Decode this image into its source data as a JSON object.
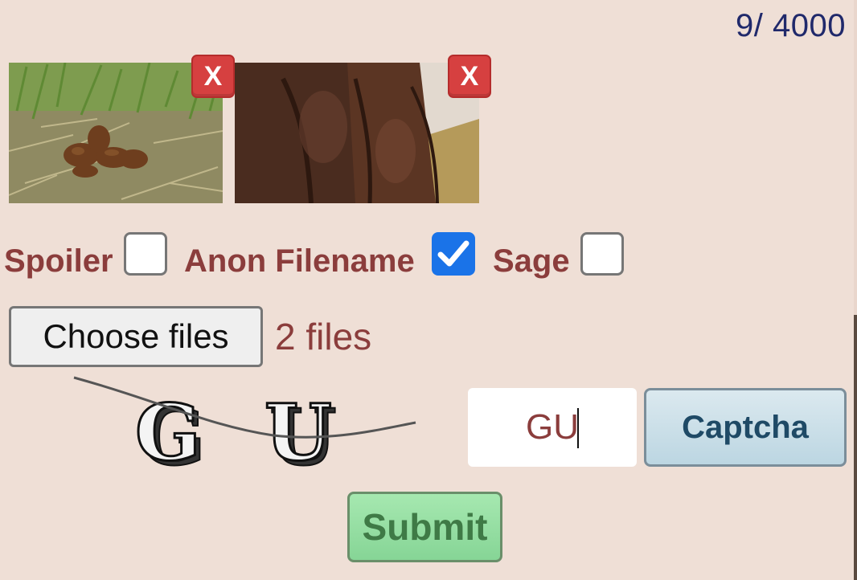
{
  "counter": {
    "text": "9/ 4000"
  },
  "attachments": [
    {
      "remove_label": "X",
      "icon": "photo-thumbnail"
    },
    {
      "remove_label": "X",
      "icon": "photo-thumbnail"
    }
  ],
  "options": {
    "spoiler": {
      "label": "Spoiler",
      "checked": false
    },
    "anon_filename": {
      "label": "Anon Filename",
      "checked": true
    },
    "sage": {
      "label": "Sage",
      "checked": false
    }
  },
  "files": {
    "button_label": "Choose files",
    "status": "2 files"
  },
  "captcha": {
    "image_text": "G U",
    "input_value": "GU",
    "button_label": "Captcha"
  },
  "submit": {
    "label": "Submit"
  },
  "colors": {
    "background": "#efdfd6",
    "label": "#8b3d3c",
    "counter": "#20296b",
    "remove": "#d64040",
    "checked": "#1a73e8",
    "captcha_button": "#bcd6e2",
    "submit_button": "#86d596"
  }
}
